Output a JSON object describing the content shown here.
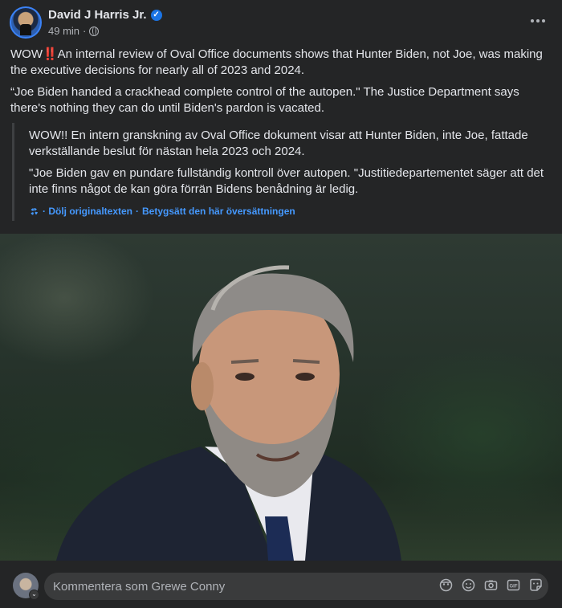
{
  "post": {
    "author": "David J Harris Jr.",
    "verified_icon": "verified-badge-icon",
    "timestamp": "49 min",
    "separator": "·",
    "audience_icon": "globe-icon",
    "more_icon": "more-options-icon",
    "paragraph_1_prefix": "WOW",
    "paragraph_1_emoji": "‼️",
    "paragraph_1_text": "An internal review of Oval Office documents shows that Hunter Biden, not Joe, was making the executive decisions for nearly all of 2023 and 2024.",
    "paragraph_2": "“Joe Biden handed a crackhead complete control of the autopen.\" The Justice Department says there's nothing they can do until Biden's pardon is vacated."
  },
  "translation": {
    "paragraph_1": "WOW!! En intern granskning av Oval Office dokument visar att Hunter Biden, inte Joe, fattade verkställande beslut för nästan hela 2023 och 2024.",
    "paragraph_2": "\"Joe Biden gav en pundare fullständig kontroll över autopen. \"Justitiedepartementet säger att det inte finns något de kan göra förrän Bidens benådning är ledig.",
    "hide_original": "· Dölj originaltexten",
    "rate_translation": "Betygsätt den här översättningen",
    "link_separator": "·"
  },
  "comment": {
    "placeholder": "Kommentera som Grewe Conny",
    "chevron": "⌄",
    "tools": [
      "avatar-sticker-icon",
      "emoji-icon",
      "camera-icon",
      "gif-icon",
      "sticker-icon"
    ]
  },
  "colors": {
    "background": "#242526",
    "link": "#4599ff",
    "verified": "#1b74e4",
    "input": "#3a3b3c"
  }
}
